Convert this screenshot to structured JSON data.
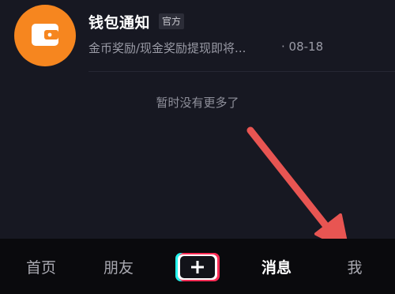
{
  "notification": {
    "title": "钱包通知",
    "badge": "官方",
    "preview": "金币奖励/现金奖励提现即将...",
    "time": "· 08-18",
    "avatar_color": "#f6861f",
    "icon": "wallet-icon"
  },
  "list": {
    "empty_text": "暂时没有更多了"
  },
  "annotation": {
    "arrow_color": "#e85552",
    "icon": "arrow-icon"
  },
  "tabbar": {
    "home": "首页",
    "friends": "朋友",
    "create_icon": "plus-icon",
    "messages": "消息",
    "me": "我",
    "active_tab": "消息"
  },
  "colors": {
    "background": "#171822",
    "tabbar_background": "#0a0a0d",
    "accent_cyan": "#25f4ee",
    "accent_red": "#fe2c55"
  }
}
